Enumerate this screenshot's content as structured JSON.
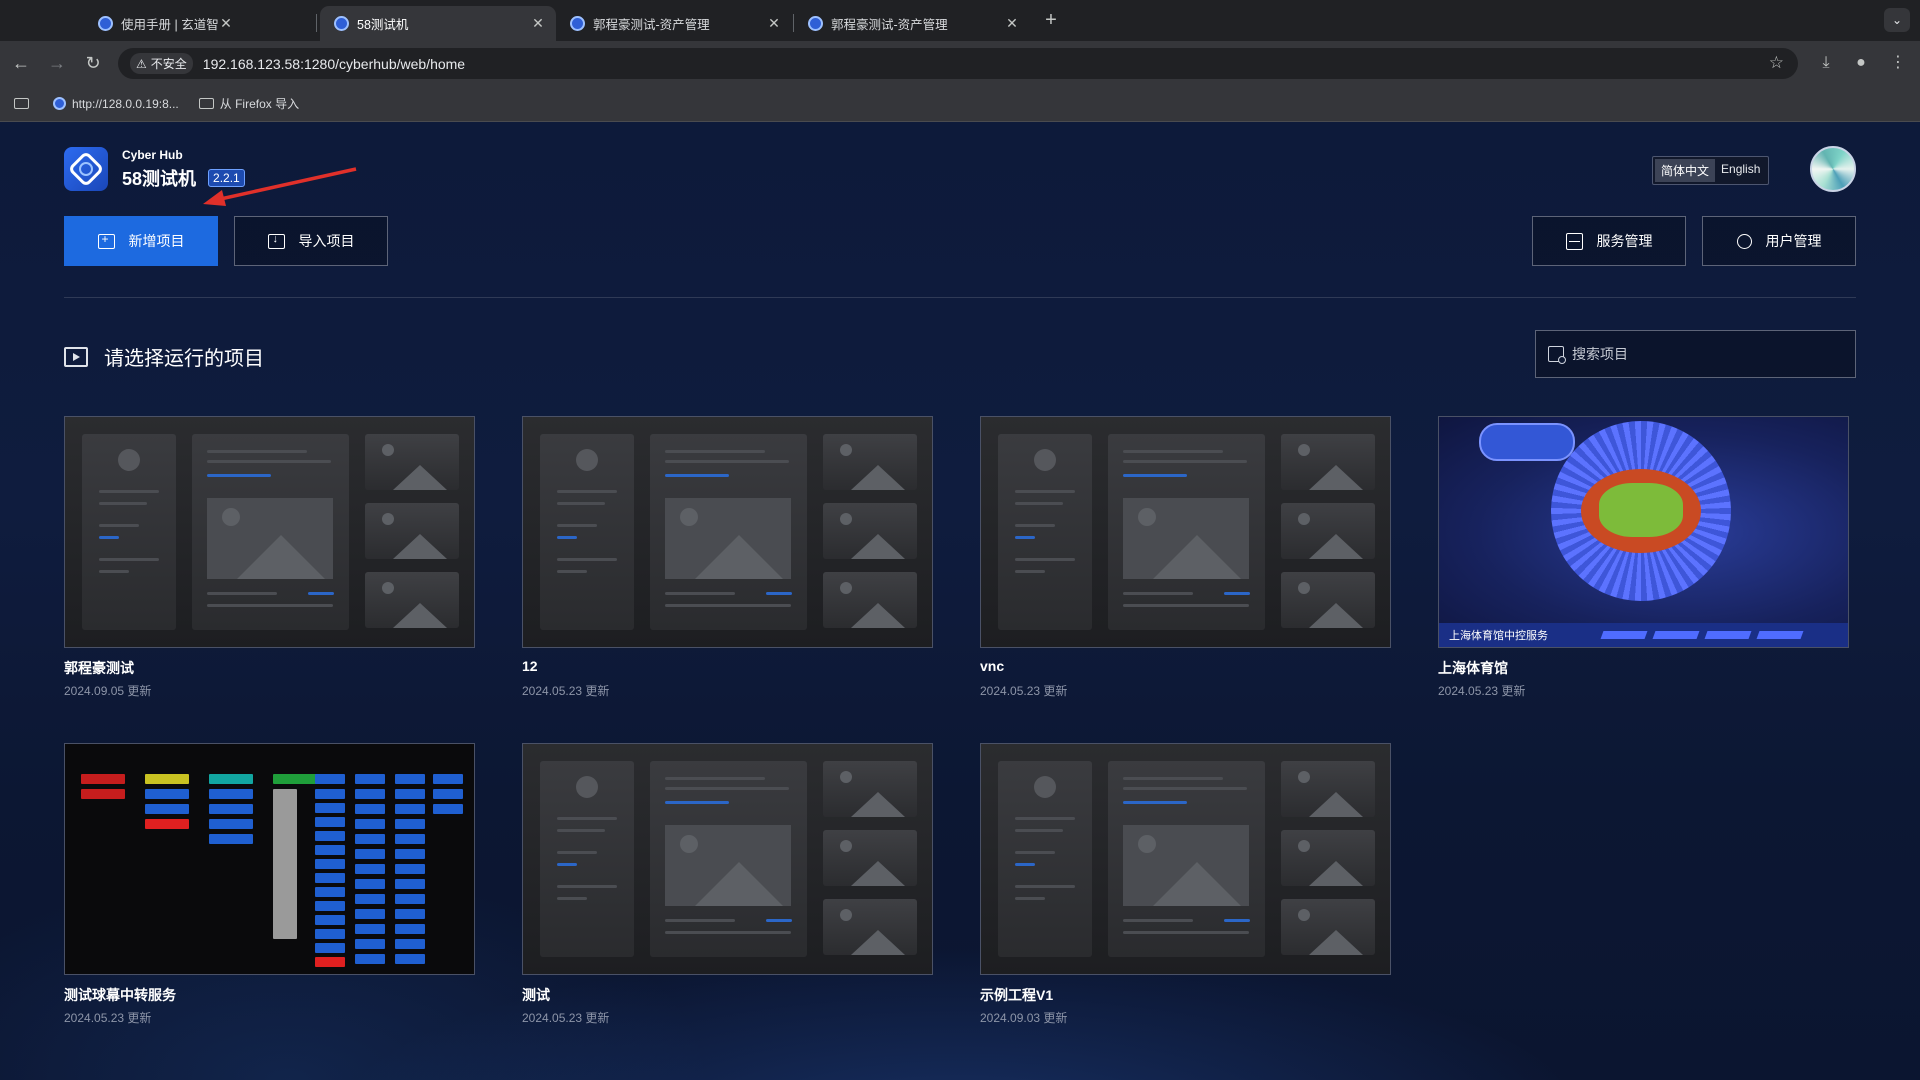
{
  "browser": {
    "tabs": [
      {
        "title": "使用手册 | 玄道智控平台",
        "active": false
      },
      {
        "title": "58测试机",
        "active": true
      },
      {
        "title": "郭程豪测试-资产管理",
        "active": false
      },
      {
        "title": "郭程豪测试-资产管理",
        "active": false
      }
    ],
    "security_label": "不安全",
    "url": "192.168.123.58:1280/cyberhub/web/home",
    "bookmarks": [
      {
        "label": "http://128.0.0.19:8...",
        "type": "link"
      },
      {
        "label": "从 Firefox 导入",
        "type": "folder"
      }
    ]
  },
  "app": {
    "brand_sub": "Cyber Hub",
    "brand_title": "58测试机",
    "version": "2.2.1",
    "lang": {
      "zh": "简体中文",
      "en": "English",
      "active": "zh"
    },
    "buttons": {
      "new_project": "新增项目",
      "import_project": "导入项目",
      "service_mgmt": "服务管理",
      "user_mgmt": "用户管理"
    },
    "section_title": "请选择运行的项目",
    "search_placeholder": "搜索项目",
    "accent": "#1d6ae0"
  },
  "projects": [
    {
      "name": "郭程豪测试",
      "date": "2024.09.05 更新",
      "thumb": "placeholder"
    },
    {
      "name": "12",
      "date": "2024.05.23 更新",
      "thumb": "placeholder"
    },
    {
      "name": "vnc",
      "date": "2024.05.23 更新",
      "thumb": "placeholder"
    },
    {
      "name": "上海体育馆",
      "date": "2024.05.23 更新",
      "thumb": "stadium",
      "thumb_caption": "上海体育馆中控服务"
    },
    {
      "name": "测试球幕中转服务",
      "date": "2024.05.23 更新",
      "thumb": "control-panel"
    },
    {
      "name": "测试",
      "date": "2024.05.23 更新",
      "thumb": "placeholder"
    },
    {
      "name": "示例工程V1",
      "date": "2024.09.03 更新",
      "thumb": "placeholder"
    }
  ]
}
